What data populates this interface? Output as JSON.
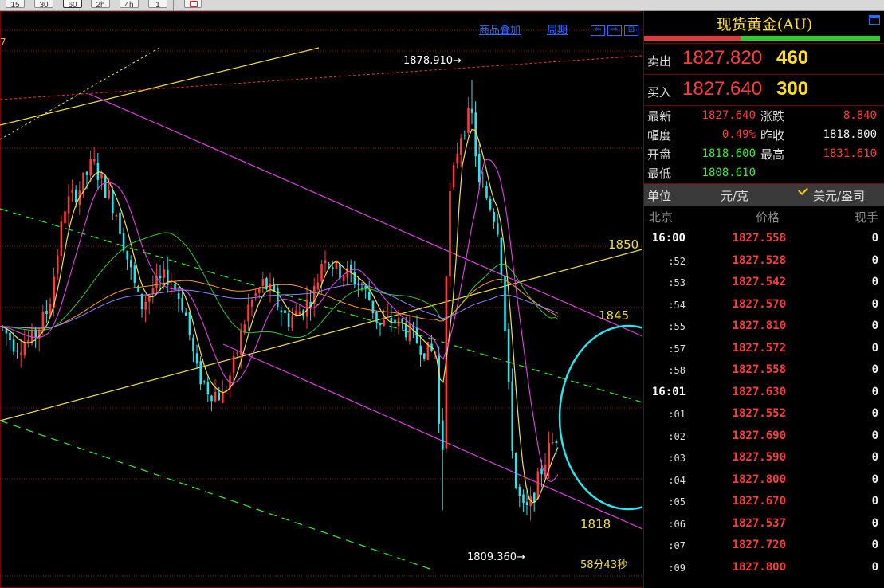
{
  "toolbar": {
    "timeframes": [
      "15",
      "30",
      "60",
      "2h",
      "4h",
      "1"
    ],
    "active": "60"
  },
  "chart_menu": {
    "overlay": "商品叠加",
    "period": "周期"
  },
  "chart_data": {
    "type": "candlestick",
    "title": "",
    "y_range": [
      1803,
      1884
    ],
    "level_labels": [
      {
        "text": "1850",
        "value": 1850
      },
      {
        "text": "1845",
        "value": 1845
      },
      {
        "text": "1818",
        "value": 1818
      }
    ],
    "high_label": {
      "text": "1878.910",
      "value": 1878.91
    },
    "low_label": {
      "text": "1809.360",
      "value": 1809.36
    },
    "countdown": "58分43秒",
    "top_left_fragment": "7",
    "colors": {
      "up": "#ff3a3a",
      "down": "#29e6ee",
      "ma_short": "#f0e040",
      "ma_mid": "#e640e6",
      "ma_long": "#33cc33",
      "ma_xlong": "#ff9933",
      "ma_xxlong": "#8888ff",
      "trend_yellow": "#f0e040",
      "channel_magenta": "#e040e0",
      "channel_green": "#33ee33",
      "resist_red": "#ff3333",
      "circle": "#29e6ee"
    },
    "candles_anchor": [
      [
        0,
        1840
      ],
      [
        18,
        1837
      ],
      [
        40,
        1838
      ],
      [
        60,
        1843
      ],
      [
        80,
        1859
      ],
      [
        100,
        1862
      ],
      [
        115,
        1866
      ],
      [
        130,
        1862
      ],
      [
        145,
        1858
      ],
      [
        160,
        1850
      ],
      [
        175,
        1843
      ],
      [
        190,
        1846
      ],
      [
        210,
        1848
      ],
      [
        230,
        1843
      ],
      [
        245,
        1833
      ],
      [
        260,
        1830
      ],
      [
        278,
        1829
      ],
      [
        292,
        1834
      ],
      [
        310,
        1843
      ],
      [
        330,
        1847
      ],
      [
        345,
        1844
      ],
      [
        360,
        1841
      ],
      [
        380,
        1843
      ],
      [
        395,
        1846
      ],
      [
        405,
        1852
      ],
      [
        420,
        1849
      ],
      [
        440,
        1848
      ],
      [
        460,
        1845
      ],
      [
        475,
        1840
      ],
      [
        490,
        1841
      ],
      [
        505,
        1840
      ],
      [
        520,
        1838
      ],
      [
        535,
        1836
      ],
      [
        545,
        1836
      ],
      [
        553,
        1815
      ],
      [
        560,
        1858
      ],
      [
        575,
        1870
      ],
      [
        590,
        1874
      ],
      [
        600,
        1862
      ],
      [
        612,
        1860
      ],
      [
        625,
        1855
      ],
      [
        635,
        1833
      ],
      [
        645,
        1815
      ],
      [
        655,
        1811
      ],
      [
        662,
        1811
      ],
      [
        672,
        1815
      ],
      [
        685,
        1820
      ],
      [
        698,
        1823
      ]
    ]
  },
  "panel": {
    "title": "现货黄金(AU)",
    "sell": {
      "label": "卖出",
      "price": "1827.820",
      "volume": "460"
    },
    "buy": {
      "label": "买入",
      "price": "1827.640",
      "volume": "300"
    },
    "sell_ratio": 0.41,
    "stats": {
      "latest_label": "最新",
      "latest": "1827.640",
      "change_label": "涨跌",
      "change": "8.840",
      "amp_label": "幅度",
      "amp": "0.49%",
      "prev_label": "昨收",
      "prev": "1818.800",
      "open_label": "开盘",
      "open": "1818.600",
      "high_label": "最高",
      "high": "1831.610",
      "low_label": "最低",
      "low": "1808.610"
    },
    "unit_label": "单位",
    "unit_cny": "元/克",
    "unit_usd": "美元/盎司",
    "ticks_head": {
      "time": "北京",
      "price": "价格",
      "vol": "现手"
    },
    "ticks": [
      {
        "t": "16:00",
        "p": "1827.558",
        "v": "0",
        "bold": true
      },
      {
        "t": ":52",
        "p": "1827.528",
        "v": "0"
      },
      {
        "t": ":53",
        "p": "1827.542",
        "v": "0"
      },
      {
        "t": ":54",
        "p": "1827.570",
        "v": "0"
      },
      {
        "t": ":55",
        "p": "1827.810",
        "v": "0"
      },
      {
        "t": ":57",
        "p": "1827.572",
        "v": "0"
      },
      {
        "t": ":58",
        "p": "1827.558",
        "v": "0"
      },
      {
        "t": "16:01",
        "p": "1827.630",
        "v": "0",
        "bold": true
      },
      {
        "t": ":01",
        "p": "1827.552",
        "v": "0"
      },
      {
        "t": ":02",
        "p": "1827.690",
        "v": "0"
      },
      {
        "t": ":03",
        "p": "1827.590",
        "v": "0"
      },
      {
        "t": ":04",
        "p": "1827.800",
        "v": "0"
      },
      {
        "t": ":05",
        "p": "1827.670",
        "v": "0"
      },
      {
        "t": ":06",
        "p": "1827.537",
        "v": "0"
      },
      {
        "t": ":07",
        "p": "1827.720",
        "v": "0"
      },
      {
        "t": ":09",
        "p": "1827.800",
        "v": "0"
      }
    ]
  }
}
